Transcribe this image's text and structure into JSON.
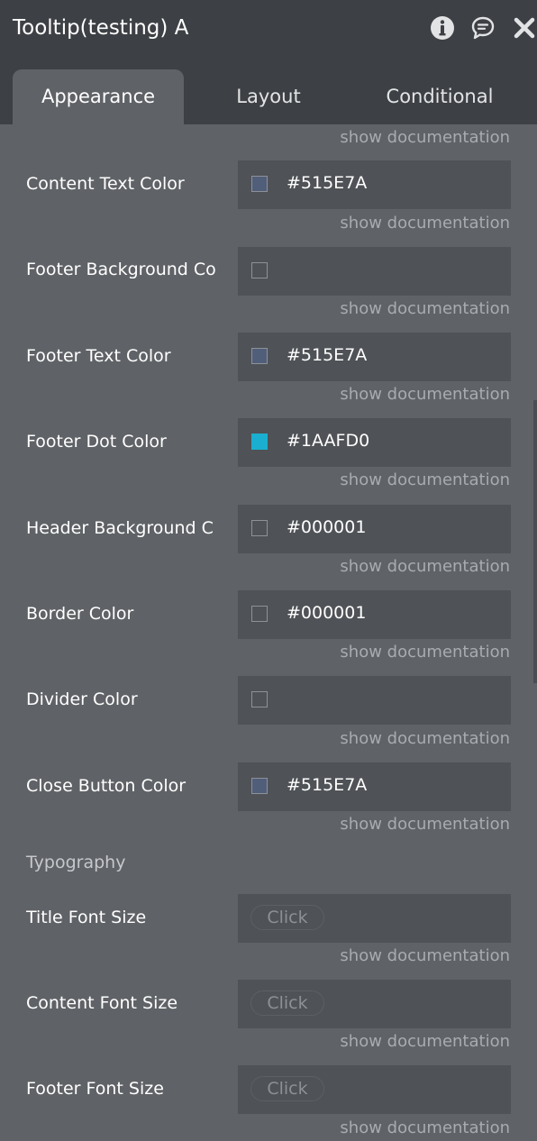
{
  "header": {
    "title": "Tooltip(testing) A",
    "icons": [
      "info-icon",
      "comment-icon",
      "close-icon"
    ]
  },
  "tabs": [
    {
      "label": "Appearance",
      "active": true
    },
    {
      "label": "Layout",
      "active": false
    },
    {
      "label": "Conditional",
      "active": false
    }
  ],
  "doc_link": "show documentation",
  "color_fields": [
    {
      "label": "Content Text Color",
      "value": "#515E7A",
      "swatch": "#515E7A"
    },
    {
      "label": "Footer Background Co",
      "value": "",
      "swatch": ""
    },
    {
      "label": "Footer Text Color",
      "value": "#515E7A",
      "swatch": "#515E7A"
    },
    {
      "label": "Footer Dot Color",
      "value": "#1AAFD0",
      "swatch": "#1AAFD0"
    },
    {
      "label": "Header Background C",
      "value": "#000001",
      "swatch": ""
    },
    {
      "label": "Border Color",
      "value": "#000001",
      "swatch": ""
    },
    {
      "label": "Divider Color",
      "value": "",
      "swatch": ""
    },
    {
      "label": "Close Button Color",
      "value": "#515E7A",
      "swatch": "#515E7A"
    }
  ],
  "typography": {
    "section_title": "Typography",
    "fields": [
      {
        "label": "Title Font Size",
        "placeholder": "Click"
      },
      {
        "label": "Content Font Size",
        "placeholder": "Click"
      },
      {
        "label": "Footer Font Size",
        "placeholder": "Click"
      }
    ]
  },
  "colors": {
    "header_bg": "#3D4044",
    "panel_bg": "#5F6266",
    "field_bg": "#4F5256",
    "doc_link": "#A8ABAF"
  }
}
